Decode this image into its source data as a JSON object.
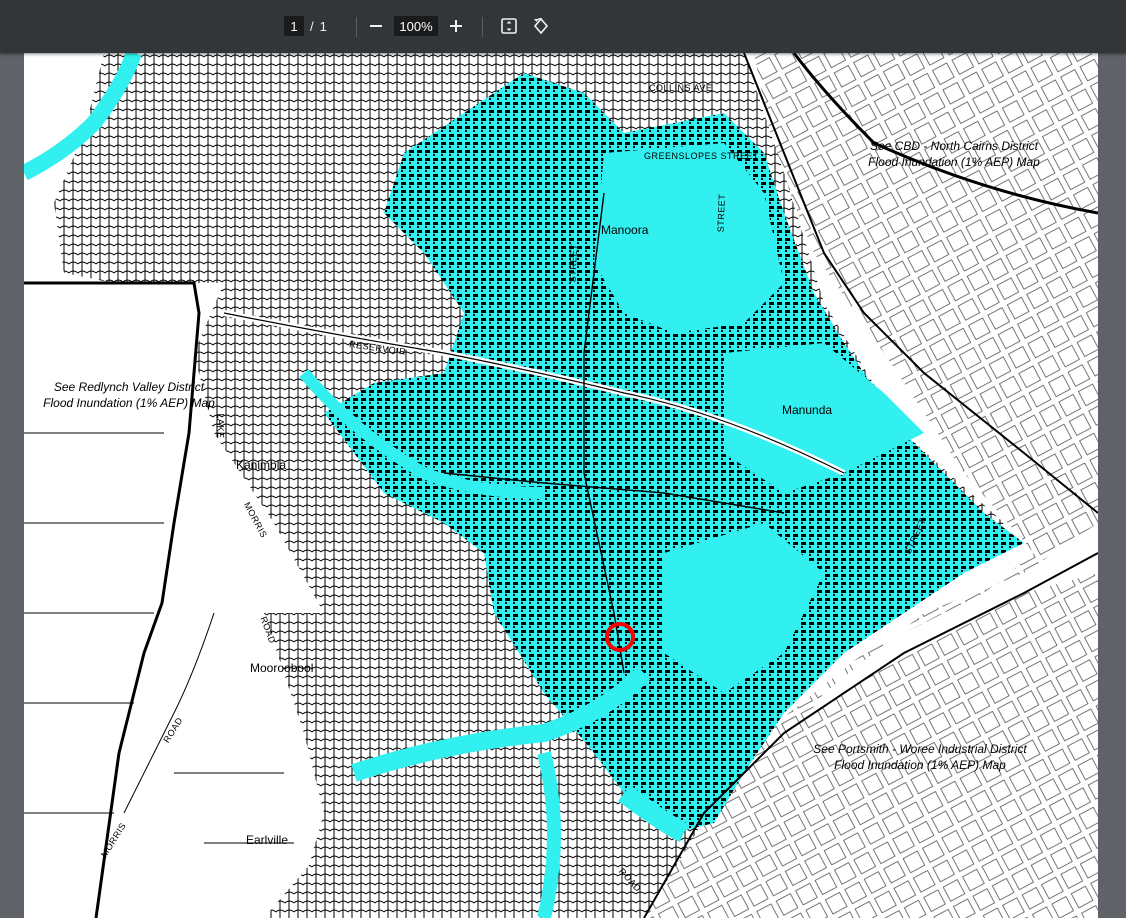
{
  "toolbar": {
    "page_current": "1",
    "page_separator": "/",
    "page_total": "1",
    "zoom": "100%",
    "icons": [
      "minus-icon",
      "plus-icon",
      "fit-page-icon",
      "rotate-icon"
    ]
  },
  "map": {
    "colors": {
      "flood": "#33f0f0",
      "water": "#33f0f0",
      "streets": "#000000",
      "marker": "#ff0000"
    },
    "suburbs": {
      "manoora": "Manoora",
      "manunda": "Manunda",
      "kanimbla": "Kanimbla",
      "mooroobool": "Mooroobool",
      "earlville": "Earlville"
    },
    "notes": {
      "cbd": "See CBD - North Cairns District\nFlood Inundation (1% AEP) Map",
      "redlynch": "See Redlynch Valley District\nFlood Inundation (1% AEP) Map",
      "portsmith": "See Portsmith - Woree Industrial District\nFlood Inundation (1% AEP) Map"
    },
    "streets": {
      "greenslopes": "GREENSLOPES STREET",
      "reservoir": "RESERVOIR",
      "morris1": "MORRIS",
      "morris2": "MORRIS",
      "road1": "ROAD",
      "road2": "ROAD",
      "road3": "ROAD",
      "lake": "LAKE",
      "street1": "STREET",
      "street2": "STREET",
      "street3": "STREET",
      "collins": "COLLINS AVE"
    }
  }
}
